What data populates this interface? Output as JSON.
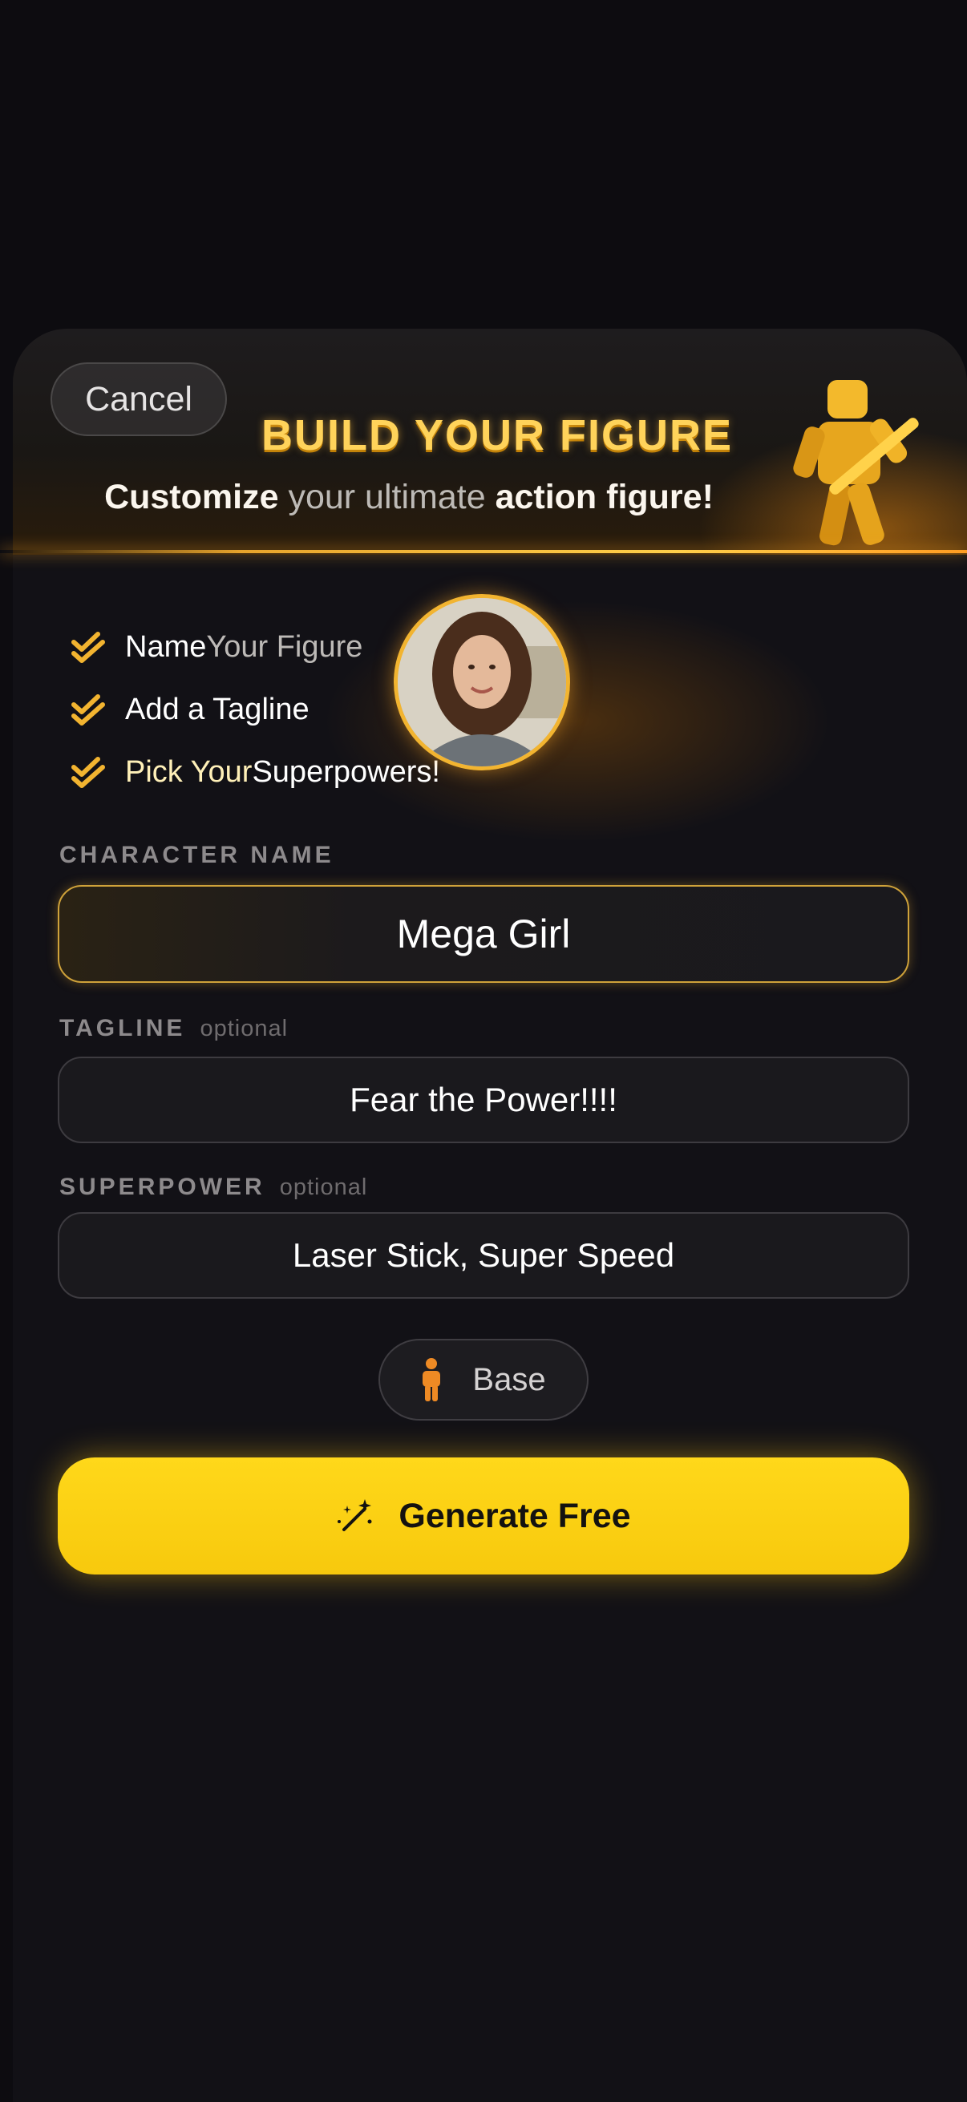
{
  "header": {
    "cancel_label": "Cancel",
    "title": "BUILD YOUR FIGURE",
    "subtitle_parts": [
      "Customize",
      " your ultimate ",
      "action figure!"
    ]
  },
  "checklist": [
    {
      "bold": "Name",
      "rest": " Your Figure"
    },
    {
      "bold": "",
      "rest": "Add a Tagline"
    },
    {
      "bold": "Pick Your ",
      "rest": "Superpowers!"
    }
  ],
  "form": {
    "character_name": {
      "label": "CHARACTER NAME",
      "value": "Mega Girl"
    },
    "tagline": {
      "label": "TAGLINE",
      "optional": "optional",
      "value": "Fear the Power!!!!"
    },
    "superpower": {
      "label": "SUPERPOWER",
      "optional": "optional",
      "value": "Laser Stick, Super Speed"
    }
  },
  "base_button": {
    "label": "Base",
    "icon": "person-icon"
  },
  "generate_button": {
    "label": "Generate Free",
    "icon": "magic-wand-icon"
  },
  "colors": {
    "accent": "#f7c90d",
    "gold": "#ffd35a",
    "background": "#0d0c10"
  }
}
